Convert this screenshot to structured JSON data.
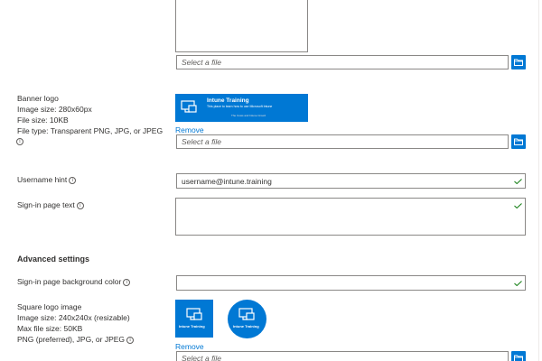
{
  "top_section": {
    "file_placeholder": "Select a file"
  },
  "banner_logo": {
    "title": "Banner logo",
    "size_line": "Image size: 280x60px",
    "file_size_line": "File size: 10KB",
    "file_type_line": "File type: Transparent PNG, JPG, or JPEG",
    "preview_title": "Intune Training",
    "preview_subtitle": "This place to learn how to use Microsoft Intune",
    "preview_footer": "The Cows and Intune Crowd",
    "remove_link": "Remove",
    "file_placeholder": "Select a file"
  },
  "username_hint": {
    "label": "Username hint",
    "value": "username@intune.training"
  },
  "signin_text": {
    "label": "Sign-in page text",
    "value": ""
  },
  "advanced": {
    "heading": "Advanced settings",
    "bg_color_label": "Sign-in page background color",
    "bg_color_value": ""
  },
  "square_logo": {
    "title": "Square logo image",
    "size_line": "Image size: 240x240x (resizable)",
    "file_size_line": "Max file size: 50KB",
    "file_type_line": "PNG (preferred), JPG, or JPEG",
    "preview_label": "Intune Training",
    "remove_link": "Remove",
    "file_placeholder": "Select a file"
  },
  "colors": {
    "accent": "#0078d4",
    "success": "#107c10"
  },
  "icons": [
    "info-icon",
    "folder-icon",
    "checkmark-icon",
    "monitor-icon"
  ]
}
